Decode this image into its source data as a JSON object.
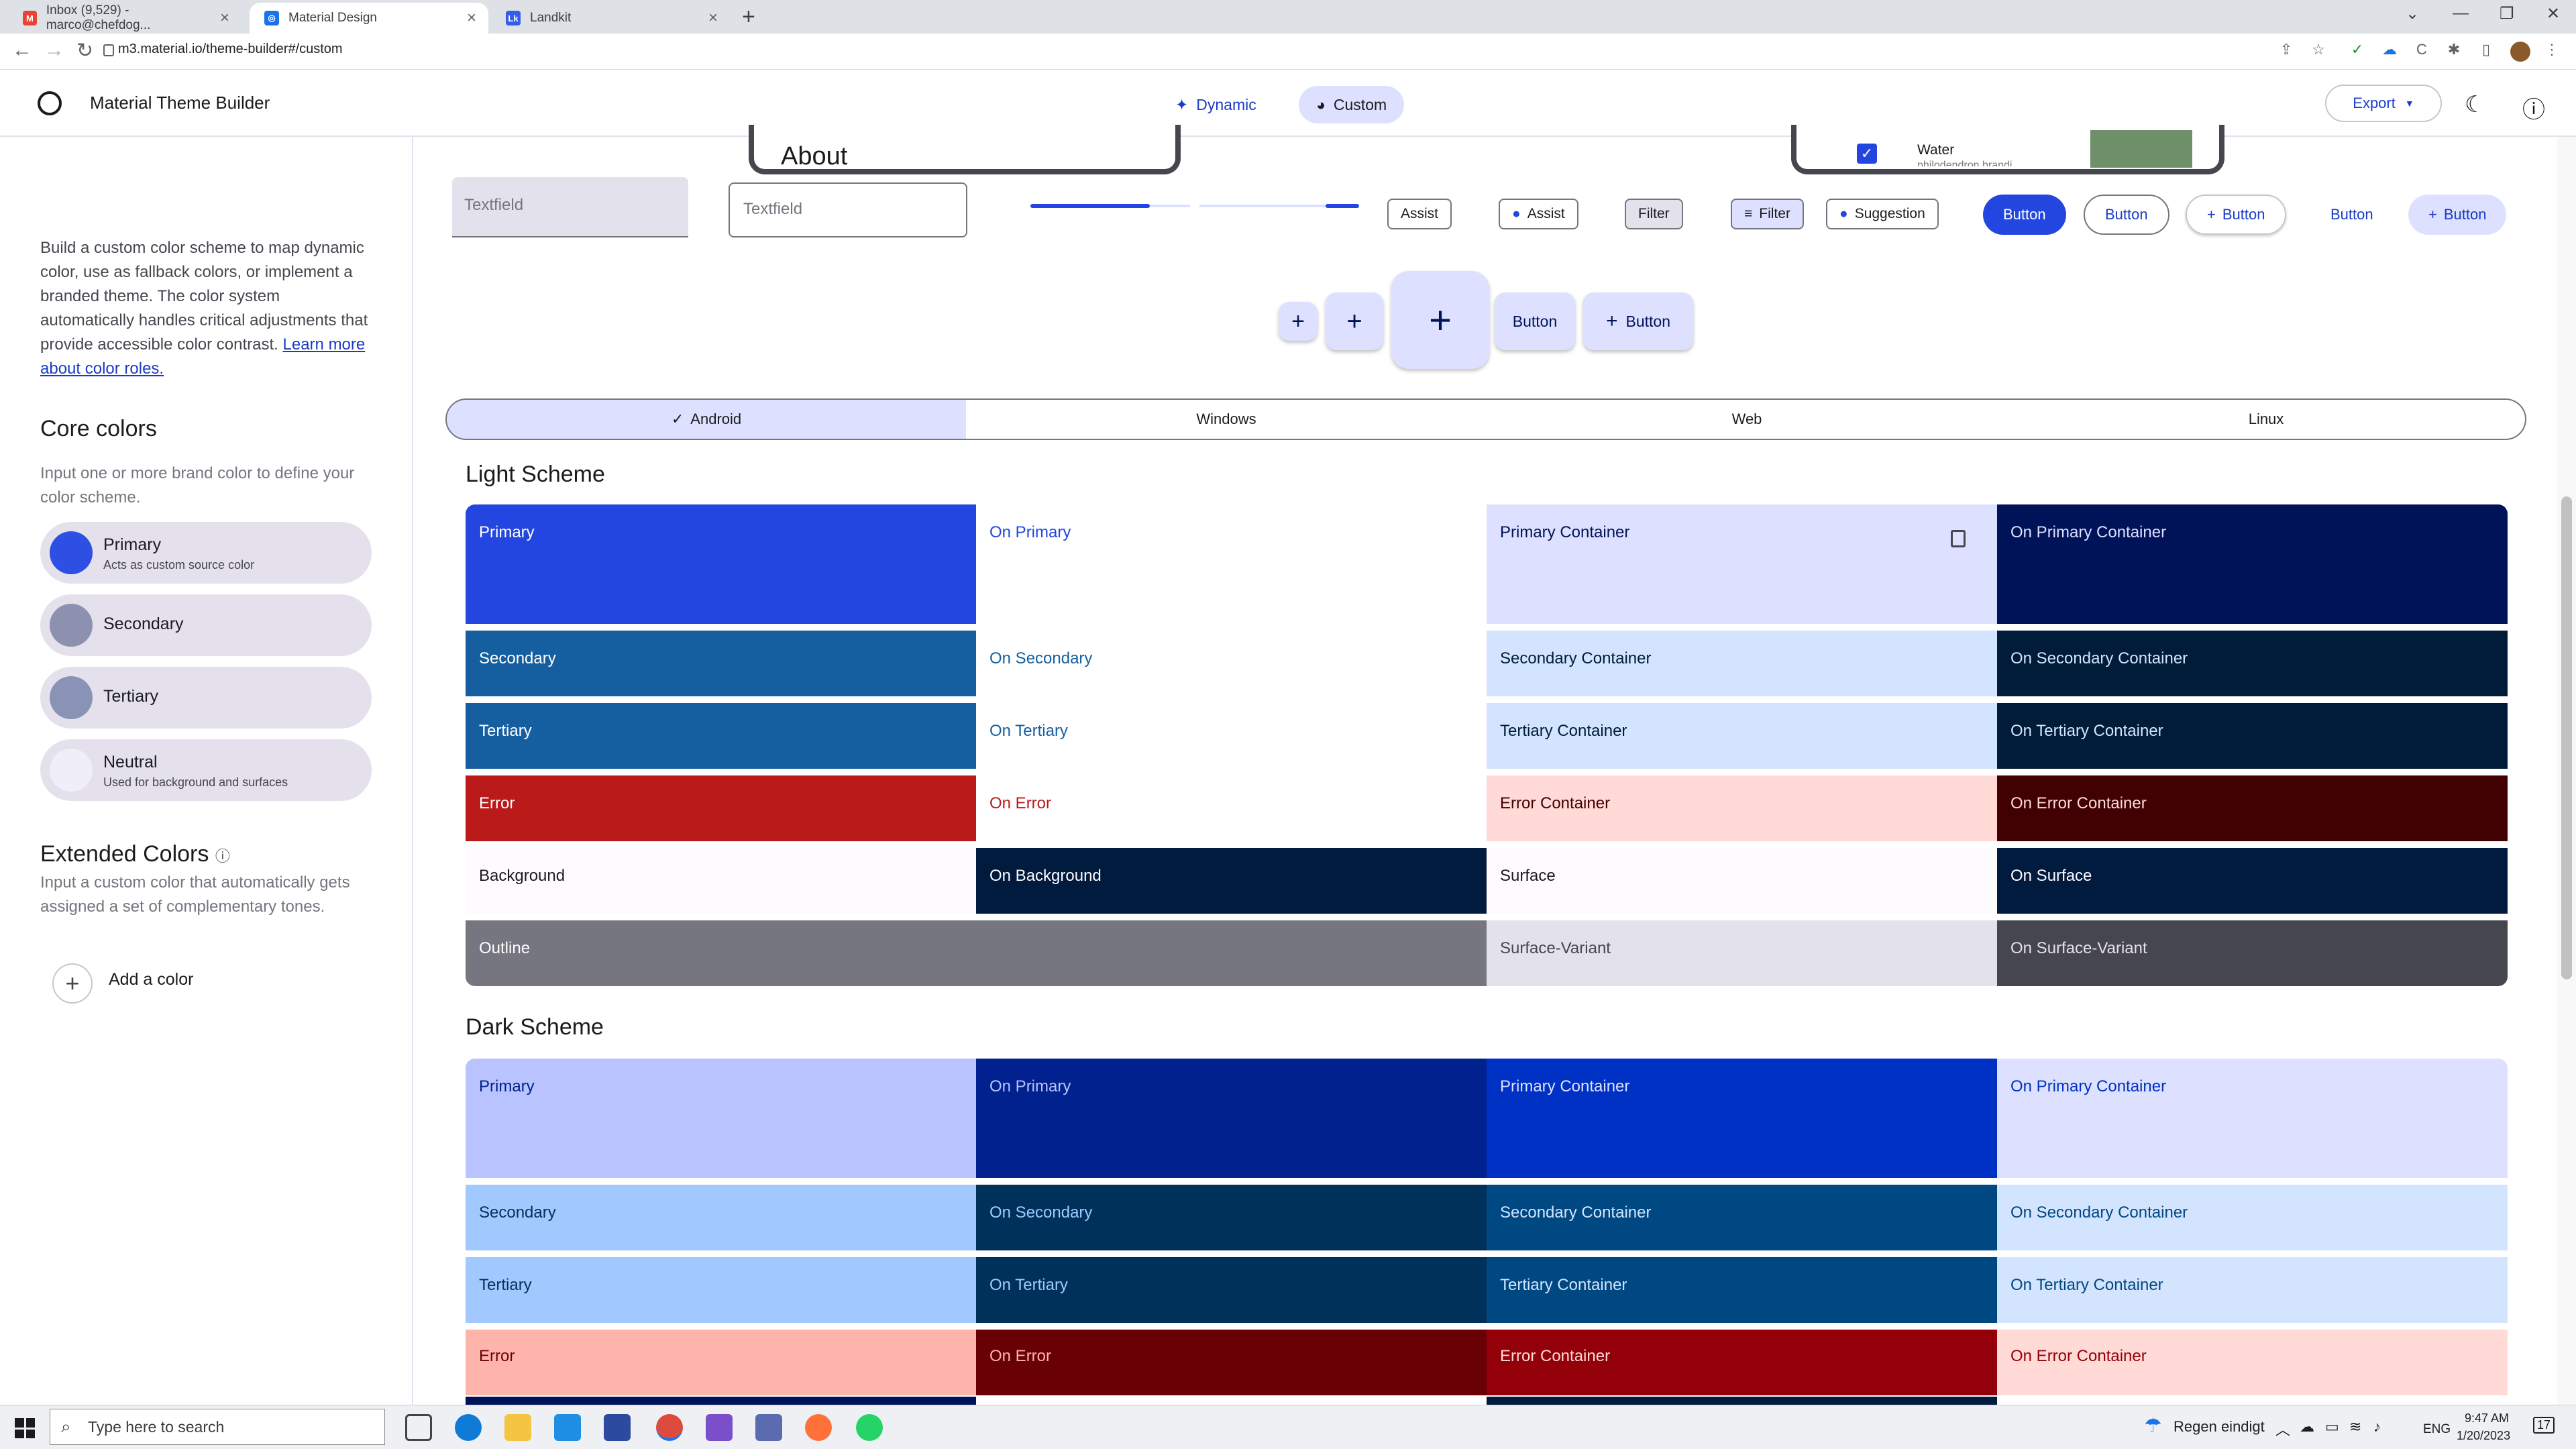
{
  "browser": {
    "tabs": [
      {
        "title": "Inbox (9,529) - marco@chefdog...",
        "favicon": "gmail-icon",
        "color": "#ea4335"
      },
      {
        "title": "Material Design",
        "favicon": "material-icon",
        "color": "#1a73e8"
      },
      {
        "title": "Landkit",
        "favicon": "landkit-icon",
        "color": "#335eea"
      }
    ],
    "url": "m3.material.io/theme-builder#/custom"
  },
  "app": {
    "title": "Material Theme Builder",
    "modes": {
      "dynamic": "Dynamic",
      "custom": "Custom"
    },
    "export": "Export"
  },
  "sidebar": {
    "intro": "Build a custom color scheme to map dynamic color, use as fallback colors, or implement a branded theme. The color system automatically handles critical adjustments that provide accessible color contrast.",
    "link": "Learn more about color roles.",
    "core_title": "Core colors",
    "core_sub": "Input one or more brand color to define your color scheme.",
    "core": [
      {
        "name": "Primary",
        "desc": "Acts as custom source color",
        "color": "#2d4fe4"
      },
      {
        "name": "Secondary",
        "desc": "",
        "color": "#8b91ae"
      },
      {
        "name": "Tertiary",
        "desc": "",
        "color": "#8893b6"
      },
      {
        "name": "Neutral",
        "desc": "Used for background and surfaces",
        "color": "#f0eef8"
      }
    ],
    "ext_title": "Extended Colors",
    "ext_sub": "Input a custom color that automatically gets assigned a set of complementary tones.",
    "add_label": "Add a color"
  },
  "preview": {
    "about": "About",
    "water": "Water",
    "water_sub": "philodendron brandi",
    "textfield": "Textfield",
    "chips": [
      "Assist",
      "Assist",
      "Filter",
      "Filter",
      "Suggestion"
    ],
    "buttons": [
      "Button",
      "Button",
      "Button",
      "Button",
      "Button"
    ],
    "fab_buttons": [
      "Button",
      "Button"
    ]
  },
  "platforms": [
    "Android",
    "Windows",
    "Web",
    "Linux"
  ],
  "light": {
    "title": "Light Scheme",
    "rows": [
      [
        {
          "l": "Primary",
          "bg": "#2346e0",
          "fg": "#ffffff"
        },
        {
          "l": "On Primary",
          "bg": "#ffffff",
          "fg": "#2346e0"
        },
        {
          "l": "Primary Container",
          "bg": "#dde1ff",
          "fg": "#001258"
        },
        {
          "l": "On Primary Container",
          "bg": "#001258",
          "fg": "#dde1ff"
        }
      ],
      [
        {
          "l": "Secondary",
          "bg": "#155fa0",
          "fg": "#ffffff"
        },
        {
          "l": "On Secondary",
          "bg": "#ffffff",
          "fg": "#155fa0"
        },
        {
          "l": "Secondary Container",
          "bg": "#d3e4ff",
          "fg": "#001c38"
        },
        {
          "l": "On Secondary Container",
          "bg": "#001c38",
          "fg": "#d3e4ff"
        }
      ],
      [
        {
          "l": "Tertiary",
          "bg": "#155fa0",
          "fg": "#ffffff"
        },
        {
          "l": "On Tertiary",
          "bg": "#ffffff",
          "fg": "#155fa0"
        },
        {
          "l": "Tertiary Container",
          "bg": "#d3e4ff",
          "fg": "#001c38"
        },
        {
          "l": "On Tertiary Container",
          "bg": "#001c38",
          "fg": "#d3e4ff"
        }
      ],
      [
        {
          "l": "Error",
          "bg": "#ba1a1a",
          "fg": "#ffffff"
        },
        {
          "l": "On Error",
          "bg": "#ffffff",
          "fg": "#ba1a1a"
        },
        {
          "l": "Error Container",
          "bg": "#ffdad6",
          "fg": "#410002"
        },
        {
          "l": "On Error Container",
          "bg": "#410002",
          "fg": "#ffdad6"
        }
      ],
      [
        {
          "l": "Background",
          "bg": "#fefbff",
          "fg": "#1b1b1f"
        },
        {
          "l": "On Background",
          "bg": "#001b3d",
          "fg": "#fefbff"
        },
        {
          "l": "Surface",
          "bg": "#fefbff",
          "fg": "#1b1b1f"
        },
        {
          "l": "On Surface",
          "bg": "#001b3d",
          "fg": "#fefbff"
        }
      ],
      [
        {
          "l": "Outline",
          "bg": "#767680",
          "fg": "#ffffff"
        },
        {
          "l": "Surface-Variant",
          "bg": "#e3e1ec",
          "fg": "#46464f"
        },
        {
          "l": "On Surface-Variant",
          "bg": "#46464f",
          "fg": "#e3e1ec"
        }
      ]
    ]
  },
  "dark": {
    "title": "Dark Scheme",
    "rows": [
      [
        {
          "l": "Primary",
          "bg": "#b9c3ff",
          "fg": "#00208d"
        },
        {
          "l": "On Primary",
          "bg": "#00218e",
          "fg": "#b9c3ff"
        },
        {
          "l": "Primary Container",
          "bg": "#0031c5",
          "fg": "#dde1ff"
        },
        {
          "l": "On Primary Container",
          "bg": "#dde1ff",
          "fg": "#0031c5"
        }
      ],
      [
        {
          "l": "Secondary",
          "bg": "#a1c9ff",
          "fg": "#00315b"
        },
        {
          "l": "On Secondary",
          "bg": "#00315b",
          "fg": "#a1c9ff"
        },
        {
          "l": "Secondary Container",
          "bg": "#004881",
          "fg": "#d3e4ff"
        },
        {
          "l": "On Secondary Container",
          "bg": "#d3e4ff",
          "fg": "#004881"
        }
      ],
      [
        {
          "l": "Tertiary",
          "bg": "#a1c9ff",
          "fg": "#00315b"
        },
        {
          "l": "On Tertiary",
          "bg": "#00315b",
          "fg": "#a1c9ff"
        },
        {
          "l": "Tertiary Container",
          "bg": "#004881",
          "fg": "#d3e4ff"
        },
        {
          "l": "On Tertiary Container",
          "bg": "#d3e4ff",
          "fg": "#004881"
        }
      ],
      [
        {
          "l": "Error",
          "bg": "#ffb4ab",
          "fg": "#690005"
        },
        {
          "l": "On Error",
          "bg": "#690005",
          "fg": "#ffb4ab"
        },
        {
          "l": "Error Container",
          "bg": "#93000a",
          "fg": "#ffdad6"
        },
        {
          "l": "On Error Container",
          "bg": "#ffdad6",
          "fg": "#93000a"
        }
      ]
    ]
  },
  "taskbar": {
    "search_placeholder": "Type here to search",
    "weather": "Regen eindigt",
    "lang": "ENG",
    "time": "9:47 AM",
    "date": "1/20/2023",
    "notif": "17"
  }
}
